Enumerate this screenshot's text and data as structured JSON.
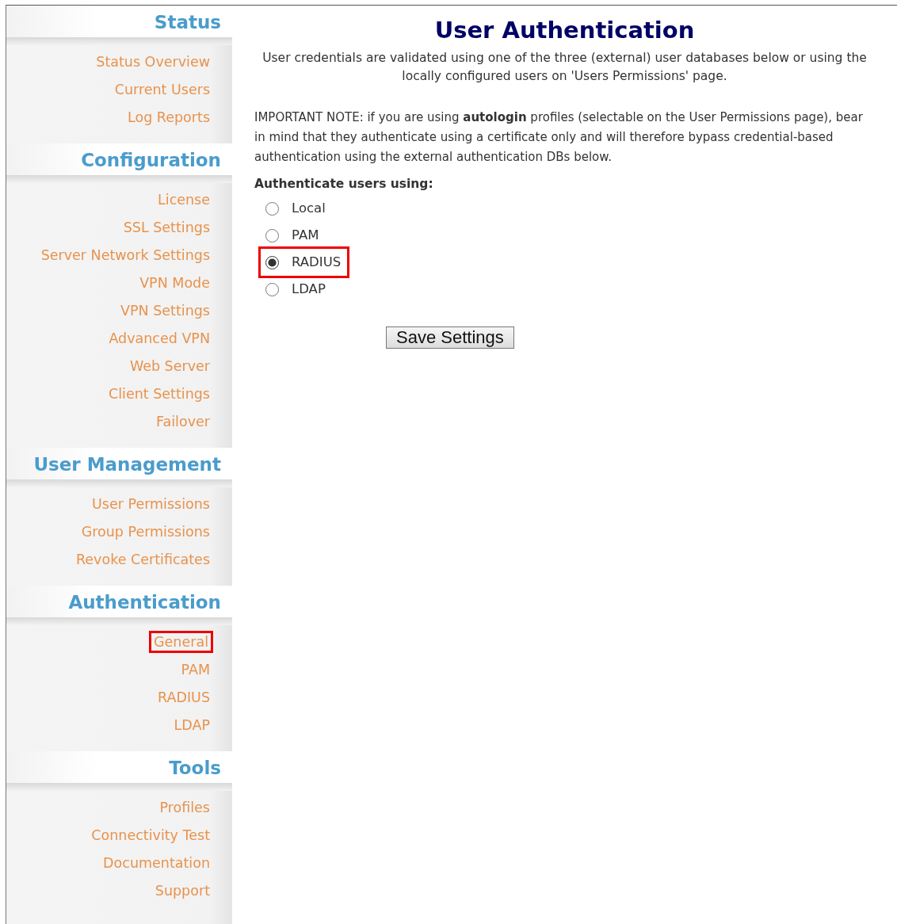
{
  "sidebar": {
    "sections": [
      {
        "title": "Status",
        "items": [
          {
            "label": "Status Overview",
            "highlighted": false
          },
          {
            "label": "Current Users",
            "highlighted": false
          },
          {
            "label": "Log Reports",
            "highlighted": false
          }
        ]
      },
      {
        "title": "Configuration",
        "items": [
          {
            "label": "License",
            "highlighted": false
          },
          {
            "label": "SSL Settings",
            "highlighted": false
          },
          {
            "label": "Server Network Settings",
            "highlighted": false
          },
          {
            "label": "VPN Mode",
            "highlighted": false
          },
          {
            "label": "VPN Settings",
            "highlighted": false
          },
          {
            "label": "Advanced VPN",
            "highlighted": false
          },
          {
            "label": "Web Server",
            "highlighted": false
          },
          {
            "label": "Client Settings",
            "highlighted": false
          },
          {
            "label": "Failover",
            "highlighted": false
          }
        ]
      },
      {
        "title": "User Management",
        "items": [
          {
            "label": "User Permissions",
            "highlighted": false
          },
          {
            "label": "Group Permissions",
            "highlighted": false
          },
          {
            "label": "Revoke Certificates",
            "highlighted": false
          }
        ]
      },
      {
        "title": "Authentication",
        "items": [
          {
            "label": "General",
            "highlighted": true
          },
          {
            "label": "PAM",
            "highlighted": false
          },
          {
            "label": "RADIUS",
            "highlighted": false
          },
          {
            "label": "LDAP",
            "highlighted": false
          }
        ]
      },
      {
        "title": "Tools",
        "items": [
          {
            "label": "Profiles",
            "highlighted": false
          },
          {
            "label": "Connectivity Test",
            "highlighted": false
          },
          {
            "label": "Documentation",
            "highlighted": false
          },
          {
            "label": "Support",
            "highlighted": false
          }
        ]
      }
    ]
  },
  "main": {
    "title": "User Authentication",
    "description": "User credentials are validated using one of the three (external) user databases below or using the locally configured users on 'Users Permissions' page.",
    "note": "IMPORTANT NOTE: if you are using **autologin** profiles (selectable on the User Permissions page), bear in mind that they authenticate using a certificate only and will therefore bypass credential-based authentication using the external authentication DBs below.",
    "options_label": "Authenticate users using:",
    "options": [
      {
        "label": "Local",
        "selected": false,
        "highlighted": false
      },
      {
        "label": "PAM",
        "selected": false,
        "highlighted": false
      },
      {
        "label": "RADIUS",
        "selected": true,
        "highlighted": true
      },
      {
        "label": "LDAP",
        "selected": false,
        "highlighted": false
      }
    ],
    "save_button": "Save Settings"
  }
}
